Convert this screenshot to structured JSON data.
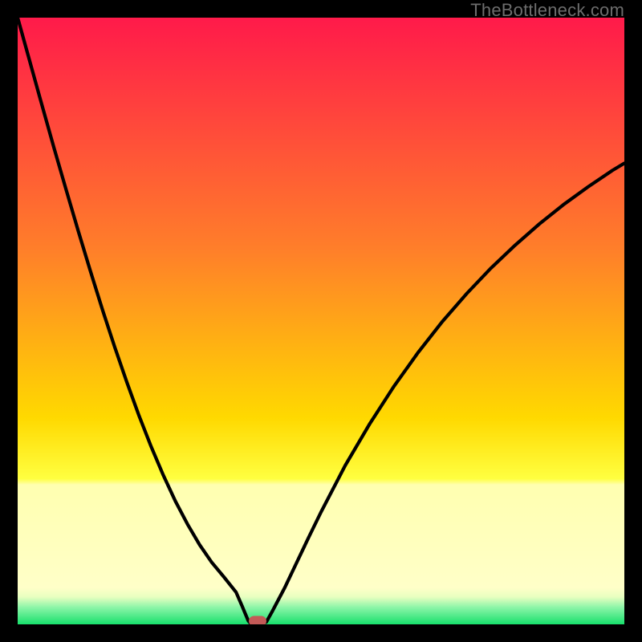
{
  "credit": "TheBottleneck.com",
  "colors": {
    "top": "#ff1a4a",
    "mid1": "#ff7e2a",
    "mid2": "#ffd900",
    "band_pale": "#ffffb0",
    "green": "#18e06c",
    "curve": "#000000",
    "marker": "#c35a57"
  },
  "chart_data": {
    "type": "line",
    "title": "",
    "xlabel": "",
    "ylabel": "",
    "xlim": [
      0,
      100
    ],
    "ylim": [
      0,
      100
    ],
    "x": [
      0,
      2,
      4,
      6,
      8,
      10,
      12,
      14,
      16,
      18,
      20,
      22,
      24,
      26,
      28,
      30,
      32,
      34,
      36,
      37,
      38,
      38.5,
      39,
      40,
      41,
      42,
      44,
      46,
      48,
      50,
      54,
      58,
      62,
      66,
      70,
      74,
      78,
      82,
      86,
      90,
      94,
      98,
      100
    ],
    "values": [
      100,
      92.8,
      85.6,
      78.5,
      71.6,
      64.8,
      58.2,
      51.8,
      45.7,
      39.9,
      34.4,
      29.3,
      24.6,
      20.3,
      16.5,
      13.1,
      10.2,
      7.8,
      5.3,
      3.0,
      0.6,
      0.0,
      0.0,
      0.0,
      0.4,
      2.2,
      6.0,
      10.2,
      14.4,
      18.5,
      26.2,
      33.0,
      39.2,
      44.8,
      49.9,
      54.5,
      58.7,
      62.5,
      66.0,
      69.2,
      72.1,
      74.8,
      76.0
    ],
    "marker": {
      "x": 39.5,
      "y": 0.5
    },
    "green_band_top_pct": 97.2,
    "pale_band_top_pct": 77
  }
}
